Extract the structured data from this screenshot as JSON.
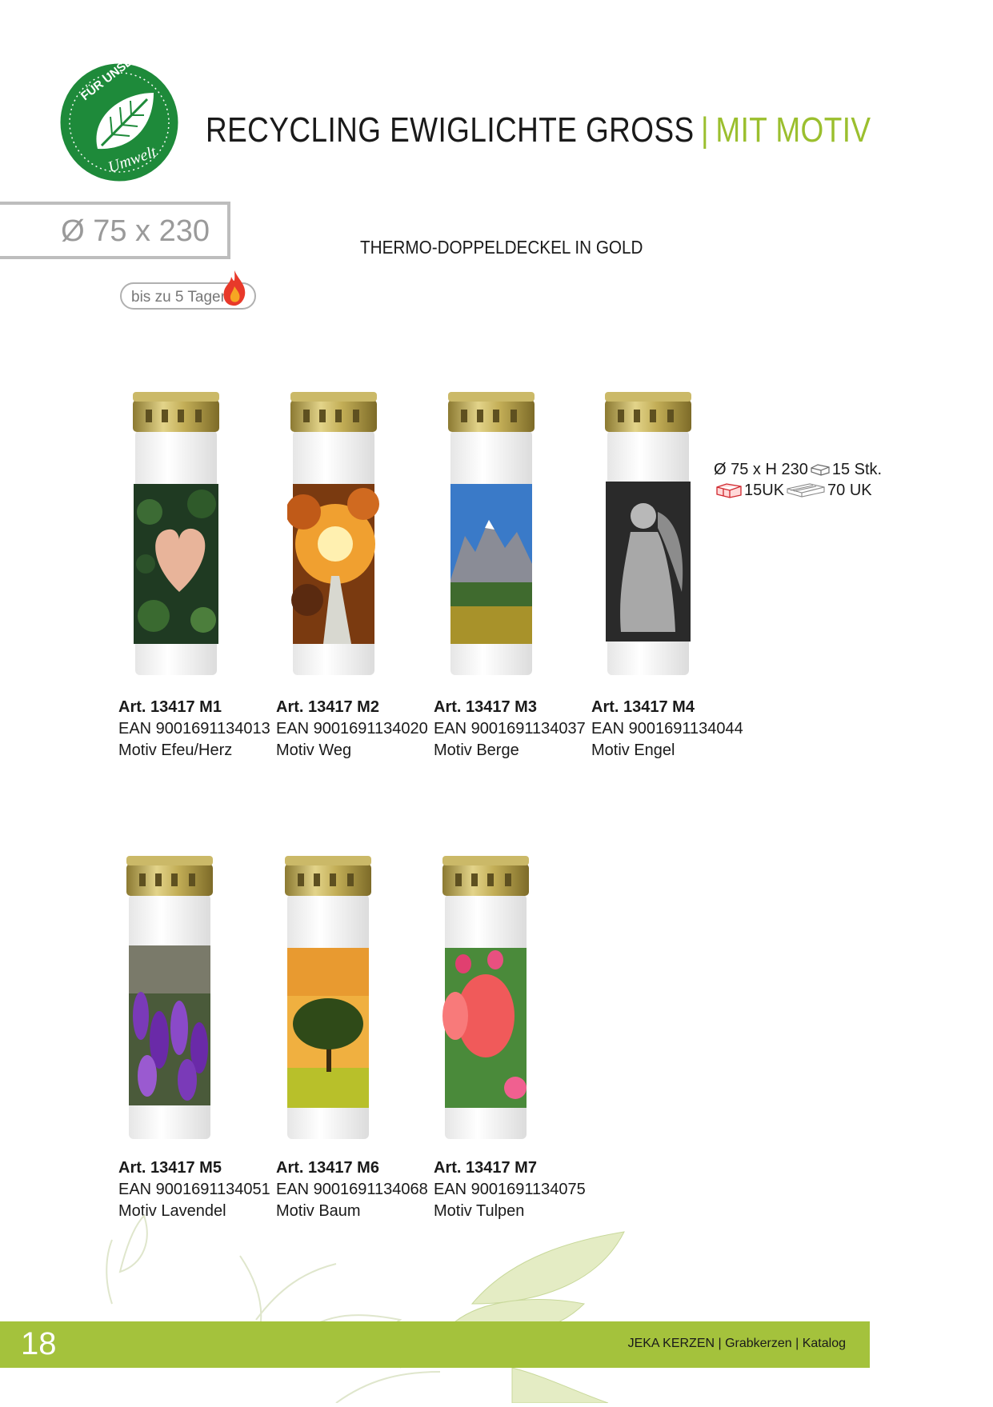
{
  "logo": {
    "top_text": "FÜR UNSERE",
    "bottom_text": "Umwelt",
    "color": "#1e8a3a"
  },
  "header": {
    "title": "RECYCLING EWIGLICHTE GROSS",
    "separator": "|",
    "subtitle": "MIT MOTIV"
  },
  "size_badge": "Ø 75 x  230",
  "burn_time": {
    "label": "bis zu 5 Tagen",
    "icon": "flame-icon"
  },
  "lid_note": "THERMO-DOPPELDECKEL IN GOLD",
  "packaging": {
    "dimension": "Ø 75 x H 230",
    "per_box": "15 Stk.",
    "per_layer": "15UK",
    "per_pallet": "70 UK"
  },
  "products": [
    {
      "art": "Art. 13417 M1",
      "ean": "EAN 9001691134013",
      "motif": "Motiv Efeu/Herz"
    },
    {
      "art": "Art. 13417 M2",
      "ean": "EAN 9001691134020",
      "motif": "Motiv Weg"
    },
    {
      "art": "Art. 13417 M3",
      "ean": "EAN 9001691134037",
      "motif": "Motiv Berge"
    },
    {
      "art": "Art. 13417 M4",
      "ean": "EAN 9001691134044",
      "motif": "Motiv Engel"
    },
    {
      "art": "Art. 13417 M5",
      "ean": "EAN 9001691134051",
      "motif": "Motiv Lavendel"
    },
    {
      "art": "Art. 13417 M6",
      "ean": "EAN 9001691134068",
      "motif": "Motiv Baum"
    },
    {
      "art": "Art. 13417 M7",
      "ean": "EAN 9001691134075",
      "motif": "Motiv Tulpen"
    }
  ],
  "footer": {
    "page_number": "18",
    "brand": "JEKA KERZEN | Grabkerzen | Katalog",
    "color": "#a4c23c"
  }
}
